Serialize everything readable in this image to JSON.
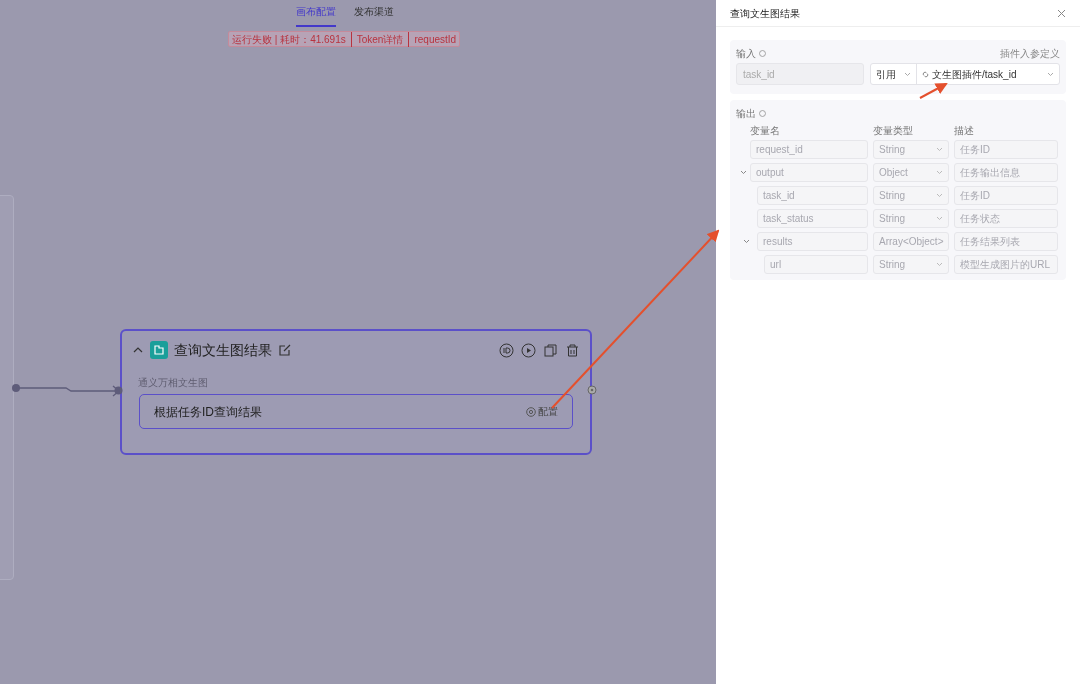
{
  "tabs": [
    {
      "label": "画布配置",
      "selected": true
    },
    {
      "label": "发布渠道",
      "selected": false
    }
  ],
  "run_status": {
    "summary": "运行失败 | 耗时：41.691s",
    "token_link": "Token详情",
    "request_link": "requestId"
  },
  "node": {
    "title": "查询文生图结果",
    "expanded": true,
    "plugin": "通义万相文生图",
    "action": "根据任务ID查询结果",
    "config": "配置"
  },
  "panel": {
    "title": "查询文生图结果",
    "input": {
      "label": "输入",
      "link": "插件入参定义",
      "name": "task_id",
      "mode": "引用",
      "value": "文生图插件/task_id"
    },
    "output": {
      "label": "输出",
      "columns": [
        "变量名",
        "变量类型",
        "描述"
      ],
      "rows": [
        {
          "name": "request_id",
          "type": "String",
          "description": "任务ID"
        },
        {
          "name": "output",
          "type": "Object",
          "description": "任务输出信息",
          "expanded": true,
          "children": [
            {
              "name": "task_id",
              "type": "String",
              "description": "任务ID"
            },
            {
              "name": "task_status",
              "type": "String",
              "description": "任务状态"
            },
            {
              "name": "results",
              "type": "Array<Object>",
              "description": "任务结果列表",
              "expanded": true,
              "children": [
                {
                  "name": "url",
                  "type": "String",
                  "description": "模型生成图片的URL"
                }
              ]
            }
          ]
        }
      ]
    }
  }
}
